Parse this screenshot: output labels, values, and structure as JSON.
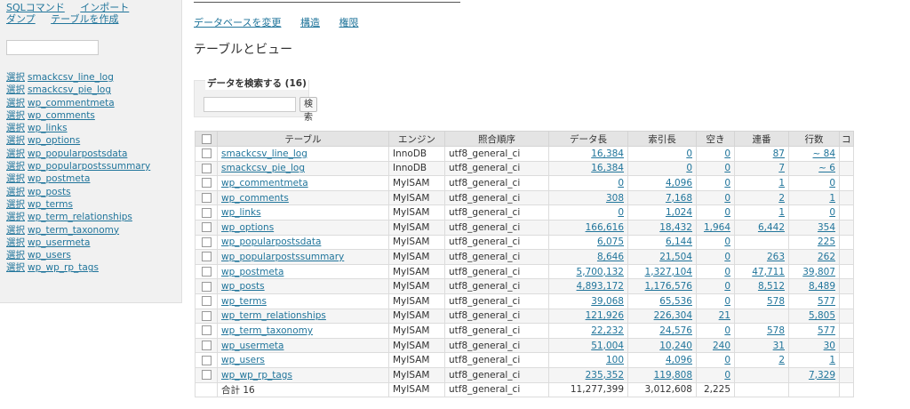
{
  "sidebar": {
    "links": [
      "SQLコマンド",
      "インポート",
      "ダンプ",
      "テーブルを作成"
    ],
    "search_value": "",
    "select_label": "選択",
    "tables": [
      "smackcsv_line_log",
      "smackcsv_pie_log",
      "wp_commentmeta",
      "wp_comments",
      "wp_links",
      "wp_options",
      "wp_popularpostsdata",
      "wp_popularpostssummary",
      "wp_postmeta",
      "wp_posts",
      "wp_terms",
      "wp_term_relationships",
      "wp_term_taxonomy",
      "wp_usermeta",
      "wp_users",
      "wp_wp_rp_tags"
    ]
  },
  "header": {
    "tabs": [
      "データベースを変更",
      "構造",
      "権限"
    ],
    "page_title": "テーブルとビュー"
  },
  "search": {
    "legend": "データを検索する (16)",
    "value": "",
    "button": "検索"
  },
  "table": {
    "headers": [
      "テーブル",
      "エンジン",
      "照合順序",
      "データ長",
      "索引長",
      "空き",
      "連番",
      "行数",
      "コ"
    ],
    "rows": [
      [
        "smackcsv_line_log",
        "InnoDB",
        "utf8_general_ci",
        "16,384",
        "0",
        "0",
        "87",
        "~ 84"
      ],
      [
        "smackcsv_pie_log",
        "InnoDB",
        "utf8_general_ci",
        "16,384",
        "0",
        "0",
        "7",
        "~ 6"
      ],
      [
        "wp_commentmeta",
        "MyISAM",
        "utf8_general_ci",
        "0",
        "4,096",
        "0",
        "1",
        "0"
      ],
      [
        "wp_comments",
        "MyISAM",
        "utf8_general_ci",
        "308",
        "7,168",
        "0",
        "2",
        "1"
      ],
      [
        "wp_links",
        "MyISAM",
        "utf8_general_ci",
        "0",
        "1,024",
        "0",
        "1",
        "0"
      ],
      [
        "wp_options",
        "MyISAM",
        "utf8_general_ci",
        "166,616",
        "18,432",
        "1,964",
        "6,442",
        "354"
      ],
      [
        "wp_popularpostsdata",
        "MyISAM",
        "utf8_general_ci",
        "6,075",
        "6,144",
        "0",
        "",
        "225"
      ],
      [
        "wp_popularpostssummary",
        "MyISAM",
        "utf8_general_ci",
        "8,646",
        "21,504",
        "0",
        "263",
        "262"
      ],
      [
        "wp_postmeta",
        "MyISAM",
        "utf8_general_ci",
        "5,700,132",
        "1,327,104",
        "0",
        "47,711",
        "39,807"
      ],
      [
        "wp_posts",
        "MyISAM",
        "utf8_general_ci",
        "4,893,172",
        "1,176,576",
        "0",
        "8,512",
        "8,489"
      ],
      [
        "wp_terms",
        "MyISAM",
        "utf8_general_ci",
        "39,068",
        "65,536",
        "0",
        "578",
        "577"
      ],
      [
        "wp_term_relationships",
        "MyISAM",
        "utf8_general_ci",
        "121,926",
        "226,304",
        "21",
        "",
        "5,805"
      ],
      [
        "wp_term_taxonomy",
        "MyISAM",
        "utf8_general_ci",
        "22,232",
        "24,576",
        "0",
        "578",
        "577"
      ],
      [
        "wp_usermeta",
        "MyISAM",
        "utf8_general_ci",
        "51,004",
        "10,240",
        "240",
        "31",
        "30"
      ],
      [
        "wp_users",
        "MyISAM",
        "utf8_general_ci",
        "100",
        "4,096",
        "0",
        "2",
        "1"
      ],
      [
        "wp_wp_rp_tags",
        "MyISAM",
        "utf8_general_ci",
        "235,352",
        "119,808",
        "0",
        "",
        "7,329"
      ]
    ],
    "footer": [
      "合計 16",
      "MyISAM",
      "utf8_general_ci",
      "11,277,399",
      "3,012,608",
      "2,225",
      "",
      ""
    ]
  }
}
